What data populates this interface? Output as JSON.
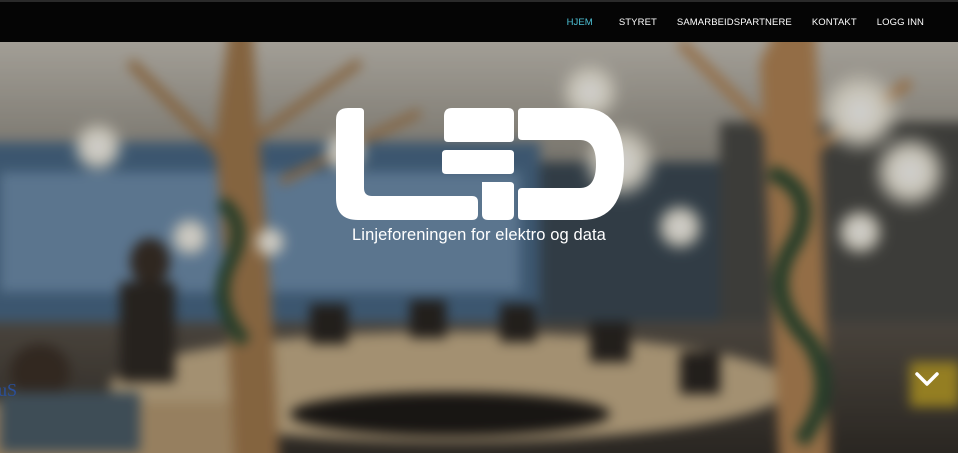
{
  "nav": {
    "items": [
      {
        "label": "HJEM",
        "active": true
      },
      {
        "label": "STYRET",
        "active": false
      },
      {
        "label": "SAMARBEIDSPARTNERE",
        "active": false
      },
      {
        "label": "KONTAKT",
        "active": false
      },
      {
        "label": "LOGG INN",
        "active": false
      }
    ]
  },
  "hero": {
    "logo_text": "LED",
    "tagline": "Linjeforeningen for elektro og data",
    "corner_text": "uS"
  },
  "colors": {
    "navbar_bg": "#050505",
    "nav_text": "#ffffff",
    "nav_active": "#4ec3d8",
    "corner_logo": "#2a4f9a"
  },
  "icons": {
    "scroll_down": "chevron-down-icon"
  }
}
